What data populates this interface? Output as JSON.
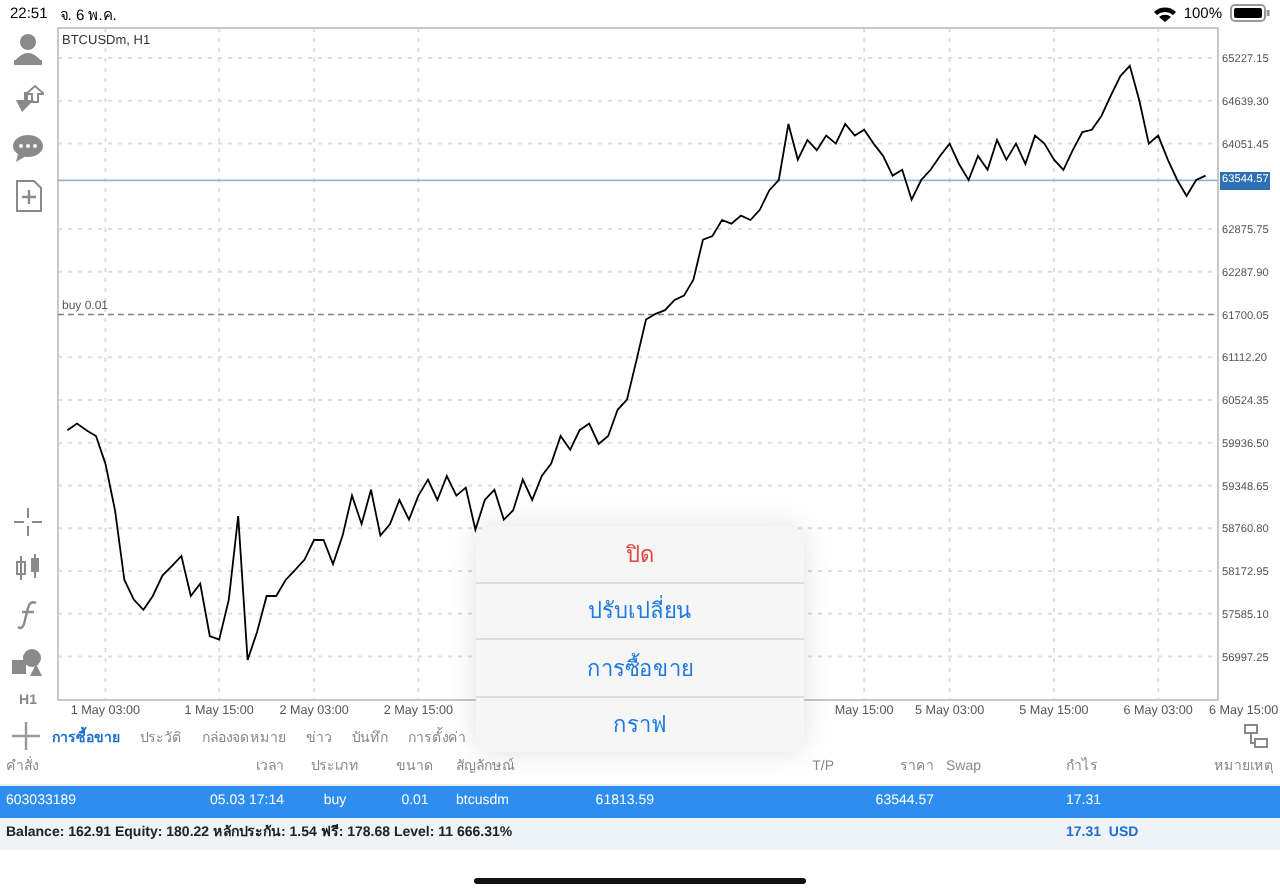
{
  "status_bar": {
    "time": "22:51",
    "date": "จ. 6 พ.ค.",
    "battery": "100%"
  },
  "chart": {
    "title": "BTCUSDm, H1",
    "timeframe": "H1",
    "chart_data": {
      "type": "line",
      "grid": true,
      "ylim": [
        56400,
        65640
      ],
      "categories": [
        null,
        null,
        null,
        null,
        "1 May 03:00",
        null,
        null,
        null,
        null,
        null,
        null,
        null,
        null,
        null,
        null,
        null,
        "1 May 15:00",
        null,
        null,
        null,
        null,
        null,
        null,
        null,
        null,
        null,
        "2 May 03:00",
        null,
        null,
        null,
        null,
        null,
        null,
        null,
        null,
        null,
        null,
        "2 May 15:00",
        null,
        null,
        null,
        null,
        null,
        null,
        null,
        null,
        null,
        null,
        null,
        null,
        null,
        null,
        null,
        null,
        null,
        null,
        null,
        null,
        null,
        null,
        null,
        null,
        null,
        null,
        null,
        null,
        null,
        null,
        null,
        null,
        null,
        null,
        null,
        null,
        null,
        null,
        null,
        null,
        null,
        null,
        null,
        null,
        null,
        null,
        "May 15:00",
        null,
        null,
        null,
        null,
        null,
        null,
        null,
        null,
        "5 May 03:00",
        null,
        null,
        null,
        null,
        null,
        null,
        null,
        null,
        null,
        null,
        "5 May 15:00",
        null,
        null,
        null,
        null,
        null,
        null,
        null,
        null,
        null,
        null,
        "6 May 03:00",
        null,
        null,
        null,
        null,
        null,
        null,
        null,
        null,
        "6 May 15:00"
      ],
      "series": [
        {
          "color": "#000000",
          "values": [
            60110,
            60200,
            60110,
            60030,
            59650,
            59010,
            58050,
            57780,
            57640,
            57830,
            58110,
            58240,
            58380,
            57830,
            58000,
            57280,
            57230,
            57780,
            58930,
            56950,
            57340,
            57830,
            57830,
            58050,
            58190,
            58330,
            58600,
            58600,
            58270,
            58660,
            59210,
            58820,
            59290,
            58660,
            58820,
            59150,
            58880,
            59210,
            59430,
            59150,
            59480,
            59210,
            59320,
            58740,
            59150,
            59290,
            58880,
            59010,
            59430,
            59150,
            59480,
            59650,
            60030,
            59840,
            60110,
            60200,
            59920,
            60030,
            60390,
            60530,
            61080,
            61630,
            61710,
            61760,
            61900,
            61960,
            62180,
            62730,
            62780,
            63000,
            62950,
            63060,
            63000,
            63140,
            63410,
            63550,
            64320,
            63830,
            64100,
            63960,
            64160,
            64050,
            64320,
            64160,
            64240,
            64050,
            63880,
            63610,
            63690,
            63280,
            63550,
            63690,
            63880,
            64050,
            63770,
            63550,
            63880,
            63690,
            64100,
            63830,
            64050,
            63770,
            64160,
            64050,
            63830,
            63690,
            63960,
            64210,
            64240,
            64430,
            64710,
            64980,
            65120,
            64650,
            64050,
            64160,
            63830,
            63550,
            63330,
            63550,
            63610,
            null,
            null,
            null,
            null
          ]
        }
      ],
      "yticks": [
        {
          "value": 65227.15,
          "label": "65227.15"
        },
        {
          "value": 64639.3,
          "label": "64639.30"
        },
        {
          "value": 64051.45,
          "label": "64051.45"
        },
        {
          "value": 62875.75,
          "label": "62875.75"
        },
        {
          "value": 62287.9,
          "label": "62287.90"
        },
        {
          "value": 61700.05,
          "label": "61700.05"
        },
        {
          "value": 61112.2,
          "label": "61112.20"
        },
        {
          "value": 60524.35,
          "label": "60524.35"
        },
        {
          "value": 59936.5,
          "label": "59936.50"
        },
        {
          "value": 59348.65,
          "label": "59348.65"
        },
        {
          "value": 58760.8,
          "label": "58760.80"
        },
        {
          "value": 58172.95,
          "label": "58172.95"
        },
        {
          "value": 57585.1,
          "label": "57585.10"
        },
        {
          "value": 56997.25,
          "label": "56997.25"
        }
      ],
      "ref_lines": [
        {
          "axis": "y",
          "value": 63544.57,
          "label": "63544.57",
          "color": "#9fb3cf"
        },
        {
          "axis": "y",
          "value": 61700.05,
          "label": "buy 0.01",
          "color": "#888888"
        }
      ]
    }
  },
  "tabs": [
    {
      "label": "การซื้อขาย",
      "selected": true
    },
    {
      "label": "ประวัติ",
      "selected": false
    },
    {
      "label": "กล่องจดหมาย",
      "selected": false
    },
    {
      "label": "ข่าว",
      "selected": false
    },
    {
      "label": "บันทึก",
      "selected": false
    },
    {
      "label": "การตั้งค่า",
      "selected": false
    }
  ],
  "table": {
    "columns": [
      {
        "header": "คำสั่ง"
      },
      {
        "header": "เวลา"
      },
      {
        "header": "ประเภท"
      },
      {
        "header": "ขนาด"
      },
      {
        "header": "สัญลักษณ์"
      },
      {},
      {},
      {
        "header": "T/P"
      },
      {
        "header": "ราคา"
      },
      {
        "header": "Swap"
      },
      {
        "header": "กำไร"
      },
      {
        "header": "หมายเหตุ"
      }
    ],
    "rows": [
      {
        "selected": true,
        "cells": [
          "603033189",
          "05.03 17:14",
          "buy",
          "0.01",
          "btcusdm",
          "61813.59",
          null,
          null,
          "63544.57",
          null,
          "17.31",
          null
        ]
      }
    ],
    "summary": {
      "text": "Balance: 162.91 Equity: 180.22 หลักประกัน: 1.54 ฟรี: 178.68 Level: 11 666.31%",
      "profit": "17.31",
      "currency": "USD"
    }
  },
  "menu": [
    {
      "label": "ปิด",
      "kind": "destructive"
    },
    {
      "label": "ปรับเปลี่ยน",
      "kind": "normal"
    },
    {
      "label": "การซื้อขาย",
      "kind": "normal"
    },
    {
      "label": "กราฟ",
      "kind": "normal"
    }
  ]
}
